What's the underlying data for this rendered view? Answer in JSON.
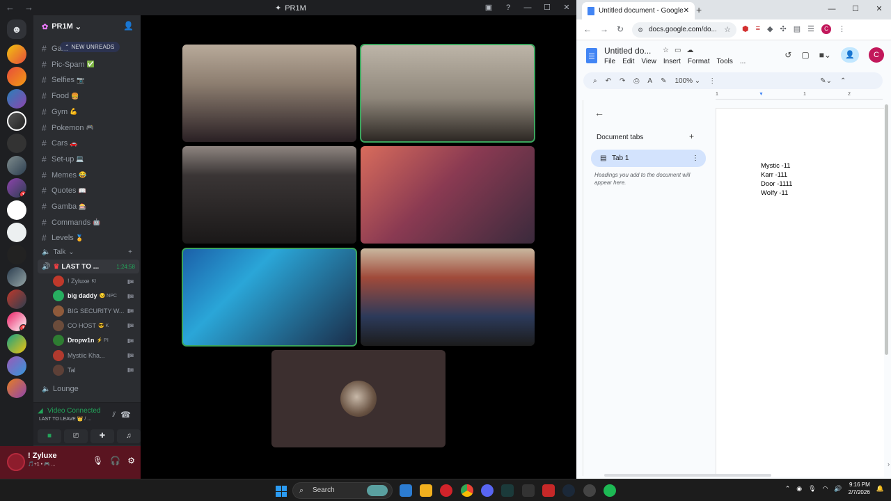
{
  "discord": {
    "window_title": "PR1M",
    "server_name": "PR1M",
    "new_unreads": "NEW UNREADS",
    "channels": [
      {
        "name": "Ga...",
        "emoji": ""
      },
      {
        "name": "Pic-Spam",
        "emoji": "✅"
      },
      {
        "name": "Selfies",
        "emoji": "📷"
      },
      {
        "name": "Food",
        "emoji": "🍔"
      },
      {
        "name": "Gym",
        "emoji": "💪"
      },
      {
        "name": "Pokemon",
        "emoji": "🎮"
      },
      {
        "name": "Cars",
        "emoji": "🚗"
      },
      {
        "name": "Set-up",
        "emoji": "💻"
      },
      {
        "name": "Memes",
        "emoji": "😂"
      },
      {
        "name": "Quotes",
        "emoji": "📖"
      },
      {
        "name": "Gamba",
        "emoji": "🎰"
      },
      {
        "name": "Commands",
        "emoji": "🤖"
      },
      {
        "name": "Levels",
        "emoji": "🏅"
      }
    ],
    "voice_category": "Talk",
    "active_voice_channel": "LAST TO ...",
    "active_voice_time": "1:24:58",
    "members": [
      {
        "name": "! Zyluxe",
        "tag": "KI",
        "color": "#c0392b",
        "bold": false
      },
      {
        "name": "big daddy",
        "tag": "😏 NPC",
        "color": "#27ae60",
        "bold": true
      },
      {
        "name": "BIG SECURITY W...",
        "tag": "",
        "color": "#8e5a3b",
        "bold": false
      },
      {
        "name": "CO HOST",
        "tag": "😎 K",
        "color": "#6b4c3b",
        "bold": false
      },
      {
        "name": "Dropw1n",
        "tag": "⚡ PI",
        "color": "#2e7d32",
        "bold": true
      },
      {
        "name": "Mystiic Kha...",
        "tag": "",
        "color": "#b03a2e",
        "bold": false
      },
      {
        "name": "Tal",
        "tag": "",
        "color": "#5d4037",
        "bold": false
      }
    ],
    "lounge_channel": "Lounge",
    "voice_status": "Video Connected",
    "voice_status_channel": "LAST TO LEAVE 👑 / ...",
    "user_name": "! Zyluxe",
    "user_status": "🎵+1 • 🎮 ..."
  },
  "chrome": {
    "tab_title": "Untitled document - Google Do",
    "url": "docs.google.com/do...",
    "doc_title": "Untitled do...",
    "menu": [
      "File",
      "Edit",
      "View",
      "Insert",
      "Format",
      "Tools",
      "..."
    ],
    "zoom": "100%",
    "account_initial": "C",
    "ruler_marks": [
      "1",
      "1",
      "2"
    ],
    "document_tabs_label": "Document tabs",
    "tab1_label": "Tab 1",
    "outline_hint": "Headings you add to the document will appear here.",
    "doc_lines": [
      "Mystic -11",
      "Karr -111",
      "Door -1111",
      "Wolfy -11"
    ]
  },
  "taskbar": {
    "search_label": "Search",
    "time": "9:16 PM",
    "date": "2/7/2026"
  },
  "colors": {
    "discord_bg": "#2b2d31",
    "speaking_outline": "#3ba55d",
    "docs_blue": "#4285f4",
    "user_panel": "#5a1420"
  }
}
